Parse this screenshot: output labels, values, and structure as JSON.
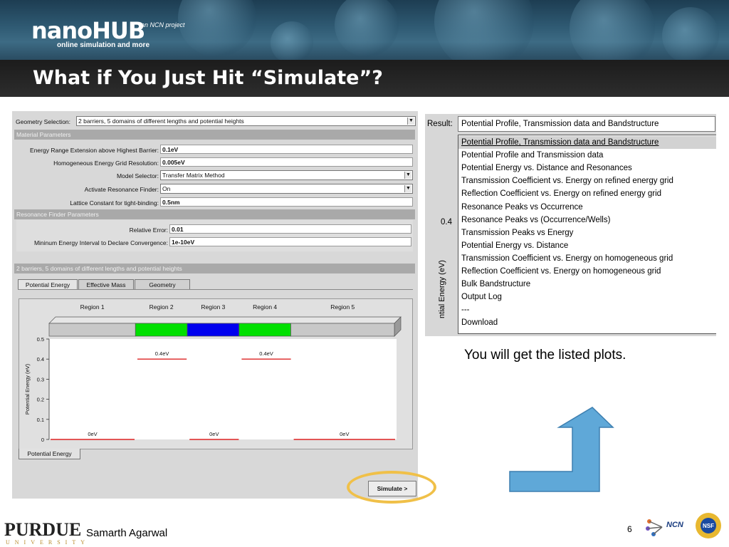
{
  "header": {
    "logo": "nanoHUB",
    "logo_tagline": "online simulation and more",
    "ncn_tag": "an NCN project",
    "title": "What if You Just Hit “Simulate”?"
  },
  "tool": {
    "geometry_label": "Geometry Selection:",
    "geometry_value": "2 barriers, 5 domains of different lengths and potential heights",
    "material_section": "Material Parameters",
    "params": [
      {
        "label": "Energy Range Extension above Highest Barrier:",
        "value": "0.1eV"
      },
      {
        "label": "Homogeneous Energy Grid Resolution:",
        "value": "0.005eV"
      },
      {
        "label": "Model Selector:",
        "value": "Transfer Matrix Method"
      },
      {
        "label": "Activate Resonance Finder:",
        "value": "On"
      },
      {
        "label": "Lattice Constant for tight-binding:",
        "value": "0.5nm"
      }
    ],
    "resonance_section": "Resonance Finder Parameters",
    "res_params": [
      {
        "label": "Relative Error:",
        "value": "0.01"
      },
      {
        "label": "Mininum Energy Interval to Declare Convergence:",
        "value": "1e-10eV"
      }
    ],
    "geometry_section": "2 barriers, 5 domains of different lengths and potential heights",
    "tabs": [
      "Potential Energy",
      "Effective Mass",
      "Geometry"
    ],
    "bottom_tab": "Potential Energy",
    "simulate_label": "Simulate >"
  },
  "chart_data": {
    "type": "line",
    "regions": [
      {
        "name": "Region 1",
        "color": "#c8c8c8",
        "energy_eV": 0,
        "label": "0eV"
      },
      {
        "name": "Region 2",
        "color": "#00e000",
        "energy_eV": 0.4,
        "label": "0.4eV"
      },
      {
        "name": "Region 3",
        "color": "#0000ee",
        "energy_eV": 0,
        "label": "0eV"
      },
      {
        "name": "Region 4",
        "color": "#00e000",
        "energy_eV": 0.4,
        "label": "0.4eV"
      },
      {
        "name": "Region 5",
        "color": "#c8c8c8",
        "energy_eV": 0,
        "label": "0eV"
      }
    ],
    "ylabel": "Potential Energy (eV)",
    "ylim": [
      0,
      0.5
    ],
    "yticks": [
      "0",
      "0.1",
      "0.2",
      "0.3",
      "0.4",
      "0.5"
    ],
    "line_color": "#dd2222"
  },
  "result": {
    "label": "Result:",
    "selected": "Potential Profile, Transmission data and Bandstructure",
    "options": [
      "Potential Profile, Transmission data and Bandstructure",
      "Potential Profile and Transmission data",
      "Potential Energy vs. Distance and Resonances",
      "Transmission Coefficient vs. Energy on refined energy grid",
      "Reflection Coefficient vs. Energy on refined energy grid",
      "Resonance Peaks vs Occurrence",
      "Resonance Peaks vs (Occurrence/Wells)",
      "Transmission Peaks vs Energy",
      "Potential Energy vs. Distance",
      "Transmission Coefficient vs. Energy on homogeneous grid",
      "Reflection Coefficient vs. Energy on homogeneous grid",
      "Bulk Bandstructure",
      "Output Log",
      "---",
      "Download"
    ],
    "axis_tick": "0.4",
    "axis_label": "ntial Energy (eV)"
  },
  "caption": "You will get the listed plots.",
  "footer": {
    "university": "PURDUE",
    "university_sub": "UNIVERSITY",
    "author": "Samarth Agarwal",
    "page": "6",
    "ncn": "NCN",
    "nsf": "NSF"
  },
  "colors": {
    "arrow": "#5fa8d8",
    "ring": "#f0c048"
  }
}
